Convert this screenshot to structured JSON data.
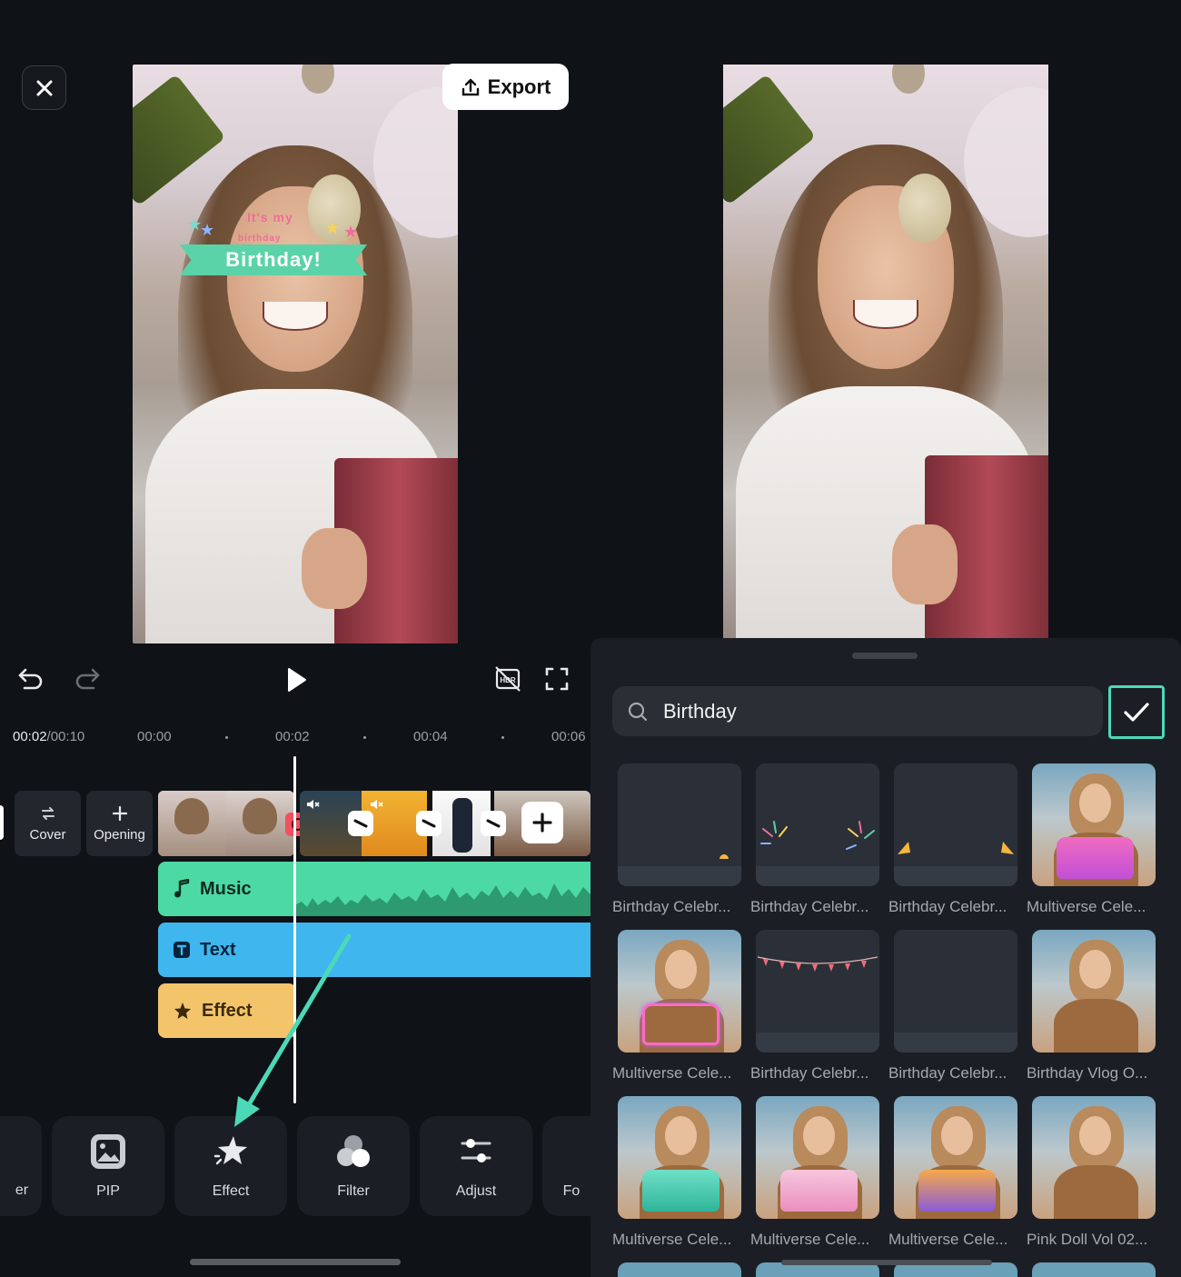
{
  "editor": {
    "export_label": "Export",
    "sticker": {
      "line1": "It's my",
      "line2": "birthday",
      "main": "Birthday!"
    },
    "timecode": {
      "current": "00:02",
      "total": "/00:10"
    },
    "ruler_ticks": [
      "00:00",
      "00:02",
      "00:04",
      "00:06"
    ],
    "track_tiles": [
      {
        "label": "Cover",
        "icon": "swap-icon"
      },
      {
        "label": "Opening",
        "icon": "plus-icon"
      }
    ],
    "lanes": {
      "music": "Music",
      "text": "Text",
      "effect": "Effect"
    },
    "toolbar": [
      {
        "label": "er",
        "icon": "partial-icon"
      },
      {
        "label": "PIP",
        "icon": "pip-icon"
      },
      {
        "label": "Effect",
        "icon": "effect-star-icon"
      },
      {
        "label": "Filter",
        "icon": "filter-icon"
      },
      {
        "label": "Adjust",
        "icon": "adjust-icon"
      },
      {
        "label": "Fo",
        "icon": "partial-icon"
      }
    ],
    "accent_color": "#4cd9b8"
  },
  "effects_panel": {
    "search": {
      "value": "Birthday",
      "placeholder": "Search"
    },
    "items": [
      {
        "label": "Birthday Celebr..."
      },
      {
        "label": "Birthday Celebr..."
      },
      {
        "label": "Birthday Celebr..."
      },
      {
        "label": "Multiverse Cele..."
      },
      {
        "label": "Multiverse Cele..."
      },
      {
        "label": "Birthday Celebr..."
      },
      {
        "label": "Birthday Celebr..."
      },
      {
        "label": "Birthday Vlog O..."
      },
      {
        "label": "Multiverse Cele..."
      },
      {
        "label": "Multiverse Cele..."
      },
      {
        "label": "Multiverse Cele..."
      },
      {
        "label": "Pink Doll Vol 02..."
      }
    ]
  }
}
